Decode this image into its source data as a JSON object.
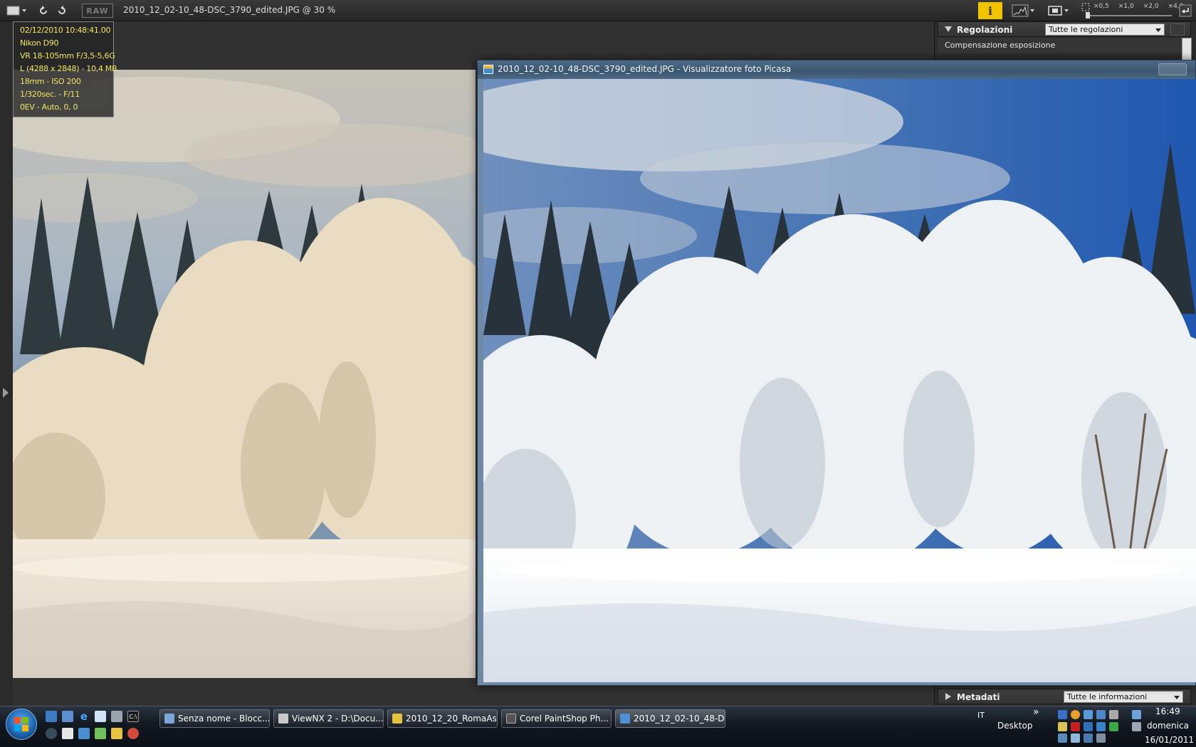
{
  "toolbar": {
    "raw_label": "RAW",
    "title": "2010_12_02-10_48-DSC_3790_edited.JPG @ 30 %",
    "info_label": "i",
    "zoom_levels": [
      "×0,5",
      "×1,0",
      "×2,0",
      "×4,0"
    ]
  },
  "exif": {
    "lines": [
      "02/12/2010 10:48:41.00",
      "Nikon D90",
      "VR 18-105mm F/3,5-5,6G",
      "L (4288 x 2848) - 10,4 MB",
      "18mm - ISO 200",
      "1/320sec. - F/11",
      "0EV - Auto, 0, 0"
    ]
  },
  "right_panel": {
    "adjust_title": "Regolazioni",
    "adjust_select": "Tutte le regolazioni",
    "adjust_item": "Compensazione esposizione",
    "meta_title": "Metadati",
    "meta_select": "Tutte le informazioni"
  },
  "picasa": {
    "title": "2010_12_02-10_48-DSC_3790_edited.JPG - Visualizzatore foto Picasa"
  },
  "taskbar": {
    "tasks": [
      {
        "label": "Senza nome - Blocc...",
        "color": "#7aa7d8",
        "active": false
      },
      {
        "label": "ViewNX 2 - D:\\Docu...",
        "color": "#c9c9c9",
        "active": false
      },
      {
        "label": "2010_12_20_RomaAs...",
        "color": "#e3c33d",
        "active": false
      },
      {
        "label": "Corel PaintShop Ph...",
        "color": "#555555",
        "active": false
      },
      {
        "label": "2010_12_02-10_48-D...",
        "color": "#4f8fd6",
        "active": true
      }
    ],
    "lang": "IT",
    "desktop_label": "Desktop",
    "chevron": "»",
    "time": "16:49",
    "day": "domenica",
    "date": "16/01/2011"
  }
}
